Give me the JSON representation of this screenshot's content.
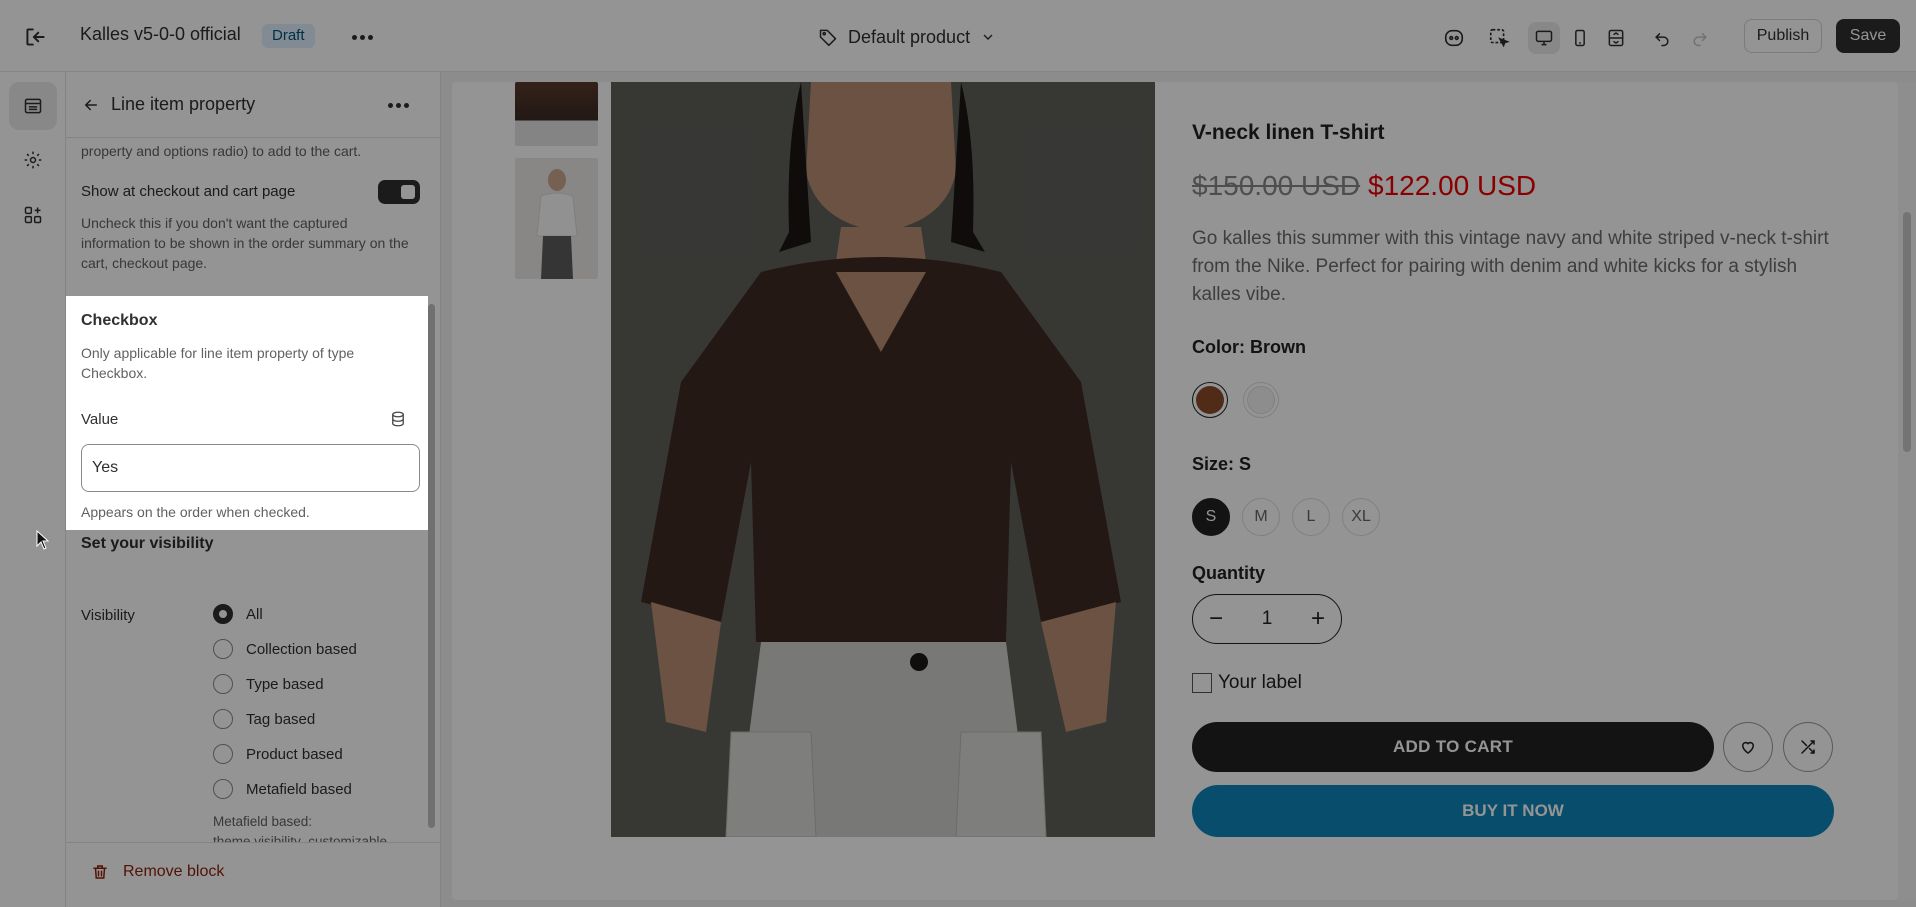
{
  "topbar": {
    "store_name": "Kalles v5-0-0 official",
    "status_badge": "Draft",
    "template": "Default product",
    "publish_label": "Publish",
    "save_label": "Save"
  },
  "panel": {
    "title": "Line item property",
    "intro_tail": "property and options radio) to add to the cart.",
    "show_checkout_label": "Show at checkout and cart page",
    "show_checkout_help": "Uncheck this if you don't want the captured information to be shown in the order summary on the cart, checkout page.",
    "show_checkout_enabled": true,
    "checkbox_section": {
      "title": "Checkbox",
      "help": "Only applicable for line item property of type Checkbox.",
      "value_label": "Value",
      "value": "Yes",
      "value_help": "Appears on the order when checked."
    },
    "visibility_section": {
      "title": "Set your visibility",
      "label": "Visibility",
      "options": [
        "All",
        "Collection based",
        "Type based",
        "Tag based",
        "Product based",
        "Metafield based"
      ],
      "selected": "All",
      "metafield_help": "Metafield based: theme.visibility_customizable"
    },
    "remove_label": "Remove block"
  },
  "product": {
    "title": "V-neck linen T-shirt",
    "price_old": "$150.00 USD",
    "price_new": "$122.00 USD",
    "description": "Go kalles this summer with this vintage navy and white striped v-neck t-shirt from the Nike. Perfect for pairing with denim and white kicks for a stylish kalles vibe.",
    "color_label": "Color: Brown",
    "colors": [
      "#8a4a2a",
      "#f3f3f3"
    ],
    "size_label": "Size: S",
    "sizes": [
      "S",
      "M",
      "L",
      "XL"
    ],
    "selected_size": "S",
    "quantity_label": "Quantity",
    "quantity": "1",
    "checkbox_label": "Your label",
    "add_to_cart": "ADD TO CART",
    "buy_now": "BUY IT NOW"
  },
  "colors": {
    "accent_dark": "#303030",
    "price_sale": "#ec0101",
    "buy_now": "#0e85b8",
    "remove": "#8e1f0b"
  }
}
